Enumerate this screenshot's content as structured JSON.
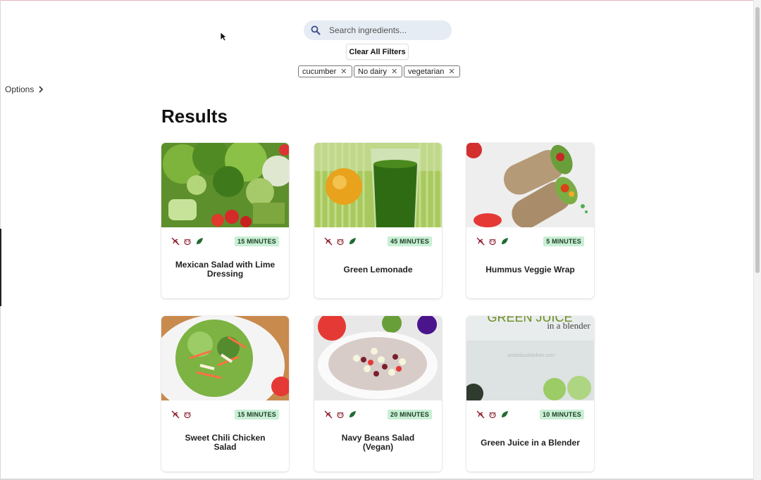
{
  "search": {
    "placeholder": "Search ingredients...",
    "icon": "search-icon"
  },
  "filters": {
    "clear_label": "Clear All Filters",
    "chips": [
      "cucumber",
      "No dairy",
      "vegetarian"
    ]
  },
  "sidebar": {
    "options_label": "Options"
  },
  "results": {
    "title": "Results",
    "cards": [
      {
        "title": "Mexican Salad with Lime Dressing",
        "time": "15 MINUTES",
        "icons": [
          "no-gluten-icon",
          "no-dairy-icon",
          "vegetarian-leaf-icon"
        ]
      },
      {
        "title": "Green Lemonade",
        "time": "45 MINUTES",
        "icons": [
          "no-gluten-icon",
          "no-dairy-icon",
          "vegetarian-leaf-icon"
        ]
      },
      {
        "title": "Hummus Veggie Wrap",
        "time": "5 MINUTES",
        "icons": [
          "no-gluten-icon",
          "no-dairy-icon",
          "vegetarian-leaf-icon"
        ]
      },
      {
        "title": "Sweet Chili Chicken Salad",
        "time": "15 MINUTES",
        "icons": [
          "no-gluten-icon",
          "no-dairy-icon"
        ]
      },
      {
        "title": "Navy Beans Salad (Vegan)",
        "time": "20 MINUTES",
        "icons": [
          "no-gluten-icon",
          "no-dairy-icon",
          "vegetarian-leaf-icon"
        ]
      },
      {
        "title": "Green Juice in a Blender",
        "time": "10 MINUTES",
        "icons": [
          "no-gluten-icon",
          "no-dairy-icon",
          "vegetarian-leaf-icon"
        ],
        "image_text": [
          "GREEN JUICE",
          "in a blender",
          "ambitiouskitchen.com"
        ]
      }
    ]
  },
  "colors": {
    "badge_bg": "#c9efd5",
    "icon_red": "#8a1c2b",
    "leaf_green": "#1f6b33"
  }
}
